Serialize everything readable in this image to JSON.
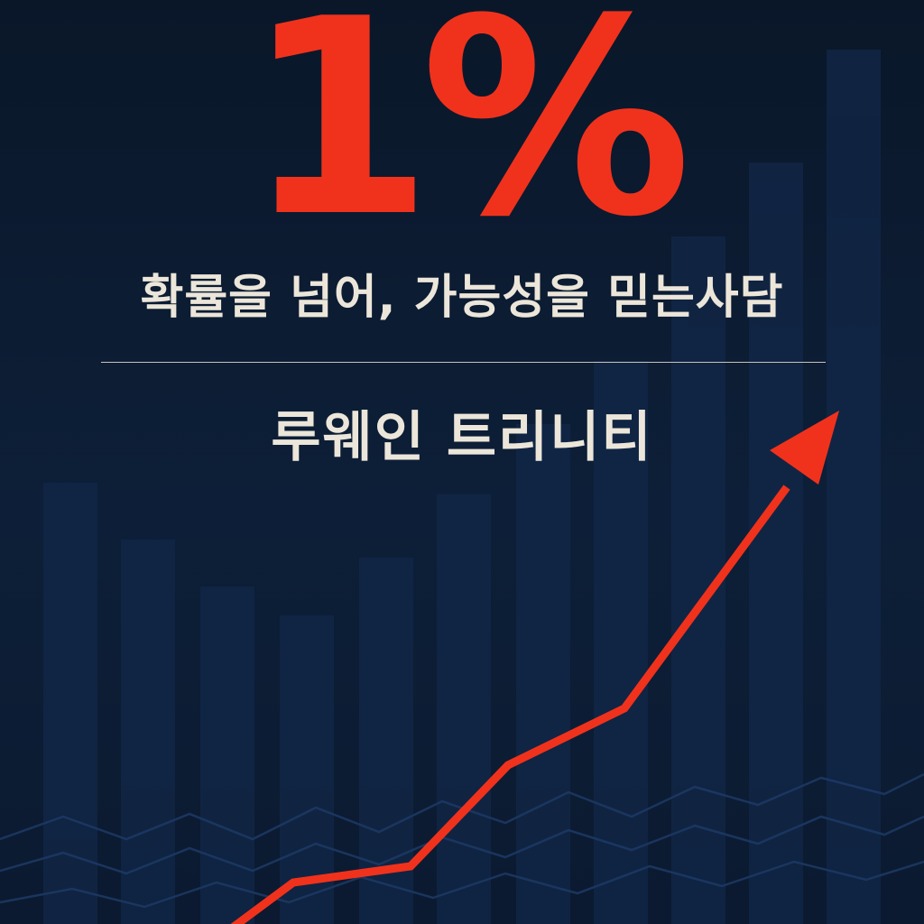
{
  "cover": {
    "headline": "1%",
    "subtitle": "확률을 넘어, 가능성을 믿는사담",
    "author": "루웨인 트리니티"
  },
  "colors": {
    "background": "#0b1a30",
    "accent": "#f0321c",
    "text": "#ece6da"
  },
  "icons": {
    "trend_arrow": "rising-trend-arrow-icon"
  }
}
